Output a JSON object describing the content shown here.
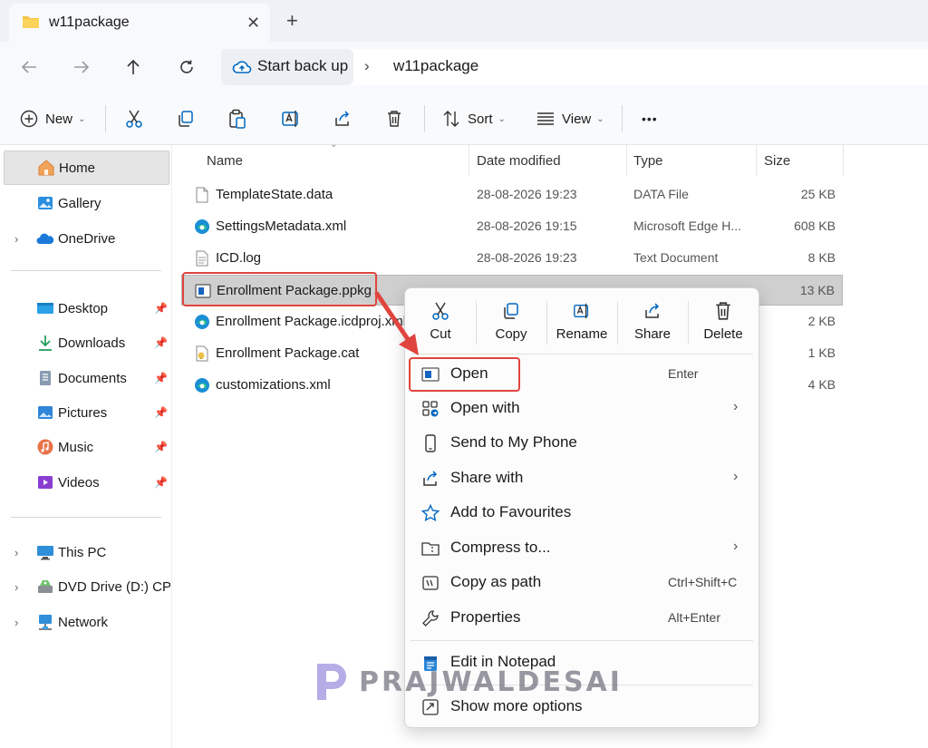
{
  "window": {
    "tab_title": "w11package",
    "new_tab": "+",
    "close": "✕"
  },
  "address": {
    "root": "Start back up",
    "separator": "›",
    "folder": "w11package"
  },
  "commands": {
    "new_label": "New",
    "sort_label": "Sort",
    "view_label": "View",
    "more": "•••"
  },
  "sidebar": {
    "home": "Home",
    "gallery": "Gallery",
    "onedrive": "OneDrive",
    "quick": [
      "Desktop",
      "Downloads",
      "Documents",
      "Pictures",
      "Music",
      "Videos"
    ],
    "this_pc": "This PC",
    "dvd": "DVD Drive (D:) CPBA",
    "network": "Network"
  },
  "columns": {
    "name": "Name",
    "date": "Date modified",
    "type": "Type",
    "size": "Size"
  },
  "files": [
    {
      "name": "TemplateState.data",
      "date": "28-08-2026 19:23",
      "type": "DATA File",
      "size": "25 KB"
    },
    {
      "name": "SettingsMetadata.xml",
      "date": "28-08-2026 19:15",
      "type": "Microsoft Edge H...",
      "size": "608 KB"
    },
    {
      "name": "ICD.log",
      "date": "28-08-2026 19:23",
      "type": "Text Document",
      "size": "8 KB"
    },
    {
      "name": "Enrollment Package.ppkg",
      "date": "",
      "type": "",
      "size": "13 KB"
    },
    {
      "name": "Enrollment Package.icdproj.xml",
      "date": "",
      "type": "",
      "size": "2 KB"
    },
    {
      "name": "Enrollment Package.cat",
      "date": "",
      "type": "",
      "size": "1 KB"
    },
    {
      "name": "customizations.xml",
      "date": "",
      "type": "",
      "size": "4 KB"
    }
  ],
  "context_menu": {
    "quick_actions": [
      "Cut",
      "Copy",
      "Rename",
      "Share",
      "Delete"
    ],
    "items": [
      {
        "label": "Open",
        "shortcut": "Enter"
      },
      {
        "label": "Open with",
        "arrow": "›"
      },
      {
        "label": "Send to My Phone"
      },
      {
        "label": "Share with",
        "arrow": "›"
      },
      {
        "label": "Add to Favourites"
      },
      {
        "label": "Compress to...",
        "arrow": "›"
      },
      {
        "label": "Copy as path",
        "shortcut": "Ctrl+Shift+C"
      },
      {
        "label": "Properties",
        "shortcut": "Alt+Enter"
      },
      {
        "label": "Edit in Notepad"
      },
      {
        "label": "Show more options"
      }
    ]
  },
  "watermark": "PRAJWALDESAI",
  "colors": {
    "highlight": "#e0443e",
    "selection": "#cfcfcf",
    "accent": "#0067c0"
  }
}
